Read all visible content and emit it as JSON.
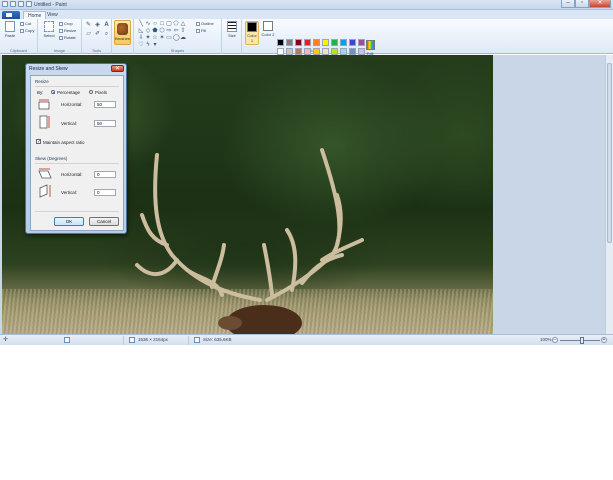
{
  "window": {
    "title": "Untitled - Paint"
  },
  "tabs": [
    {
      "label": "Home"
    },
    {
      "label": "View"
    }
  ],
  "ribbon": {
    "clipboard": {
      "paste": "Paste",
      "cut": "Cut",
      "copy": "Copy",
      "group": "Clipboard"
    },
    "image": {
      "select": "Select",
      "crop": "Crop",
      "resize": "Resize",
      "rotate": "Rotate",
      "group": "Image"
    },
    "tools": {
      "group": "Tools"
    },
    "brushes": {
      "label": "Brushes"
    },
    "shapes": {
      "outline": "Outline",
      "fill": "Fill",
      "group": "Shapes"
    },
    "size": {
      "label": "Size"
    },
    "colors": {
      "color1": "Color 1",
      "color2": "Color 2",
      "edit": "Edit colors",
      "group": "Colors",
      "palette": [
        "#000000",
        "#7f7f7f",
        "#880015",
        "#ed1c24",
        "#ff7f27",
        "#fff200",
        "#22b14c",
        "#00a2e8",
        "#3f48cc",
        "#a349a4",
        "#ffffff",
        "#c3c3c3",
        "#b97a57",
        "#ffaec9",
        "#ffc90e",
        "#efe4b0",
        "#b5e61d",
        "#99d9ea",
        "#7092be",
        "#c8bfe7",
        "#f5f5f5",
        "#f5f5f5",
        "#f5f5f5",
        "#f5f5f5",
        "#f5f5f5",
        "#f5f5f5",
        "#f5f5f5",
        "#f5f5f5",
        "#f5f5f5",
        "#f5f5f5"
      ],
      "color1_value": "#000000",
      "color2_value": "#ffffff"
    }
  },
  "dialog": {
    "title": "Resize and Skew",
    "resize_section": "Resize",
    "by_label": "By:",
    "percentage": "Percentage",
    "pixels": "Pixels",
    "resize_horizontal_label": "Horizontal:",
    "resize_horizontal_value": "50",
    "resize_vertical_label": "Vertical:",
    "resize_vertical_value": "50",
    "maintain_label": "Maintain aspect ratio",
    "skew_section": "Skew (Degrees)",
    "skew_horizontal_label": "Horizontal:",
    "skew_horizontal_value": "0",
    "skew_vertical_label": "Vertical:",
    "skew_vertical_value": "0",
    "ok": "OK",
    "cancel": "Cancel"
  },
  "statusbar": {
    "dimensions": "1536 × 2154px",
    "size": "Size: 635.6KB",
    "zoom": "100%"
  }
}
